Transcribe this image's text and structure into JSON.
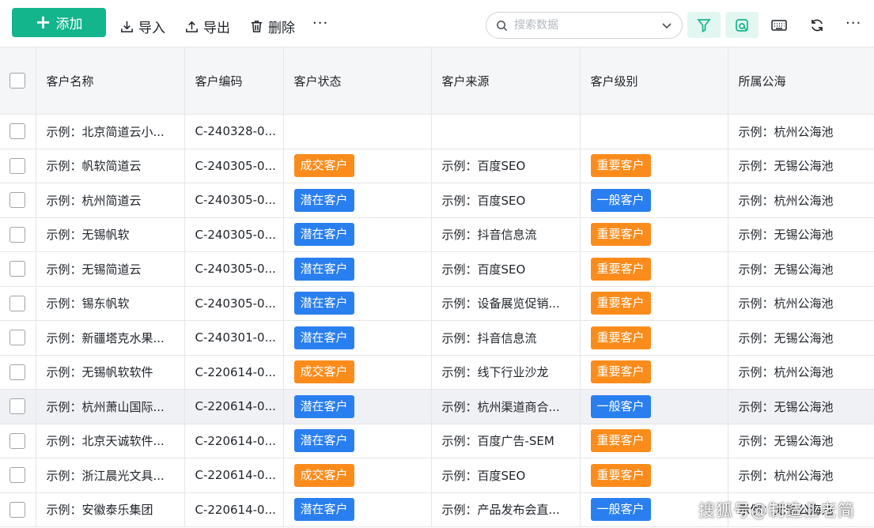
{
  "toolbar": {
    "add_label": "添加",
    "import_label": "导入",
    "export_label": "导出",
    "delete_label": "删除",
    "more_label": "···",
    "search_placeholder": "搜索数据",
    "right_more_label": "···"
  },
  "colors": {
    "accent": "#13b58d",
    "tag_orange": "#fb8c1c",
    "tag_blue": "#2a7ff0"
  },
  "table": {
    "columns": [
      "客户名称",
      "客户编码",
      "客户状态",
      "客户来源",
      "客户级别",
      "所属公海"
    ],
    "rows": [
      {
        "name": "示例：北京简道云小...",
        "code": "C-240328-0...",
        "status": "",
        "status_color": "",
        "source": "",
        "level": "",
        "level_color": "",
        "pool": "示例：杭州公海池"
      },
      {
        "name": "示例：帆软简道云",
        "code": "C-240305-0...",
        "status": "成交客户",
        "status_color": "orange",
        "source": "示例：百度SEO",
        "level": "重要客户",
        "level_color": "orange",
        "pool": "示例：无锡公海池"
      },
      {
        "name": "示例：杭州简道云",
        "code": "C-240305-0...",
        "status": "潜在客户",
        "status_color": "blue",
        "source": "示例：百度SEO",
        "level": "一般客户",
        "level_color": "blue",
        "pool": "示例：杭州公海池"
      },
      {
        "name": "示例：无锡帆软",
        "code": "C-240305-0...",
        "status": "潜在客户",
        "status_color": "blue",
        "source": "示例：抖音信息流",
        "level": "重要客户",
        "level_color": "orange",
        "pool": "示例：无锡公海池"
      },
      {
        "name": "示例：无锡简道云",
        "code": "C-240305-0...",
        "status": "潜在客户",
        "status_color": "blue",
        "source": "示例：百度SEO",
        "level": "重要客户",
        "level_color": "orange",
        "pool": "示例：无锡公海池"
      },
      {
        "name": "示例：锡东帆软",
        "code": "C-240305-0...",
        "status": "潜在客户",
        "status_color": "blue",
        "source": "示例：设备展览促销...",
        "level": "重要客户",
        "level_color": "orange",
        "pool": "示例：杭州公海池"
      },
      {
        "name": "示例：新疆塔克水果...",
        "code": "C-240301-0...",
        "status": "潜在客户",
        "status_color": "blue",
        "source": "示例：抖音信息流",
        "level": "重要客户",
        "level_color": "orange",
        "pool": "示例：无锡公海池"
      },
      {
        "name": "示例：无锡帆软软件",
        "code": "C-220614-0...",
        "status": "成交客户",
        "status_color": "orange",
        "source": "示例：线下行业沙龙",
        "level": "重要客户",
        "level_color": "orange",
        "pool": "示例：杭州公海池"
      },
      {
        "name": "示例：杭州萧山国际...",
        "code": "C-220614-0...",
        "status": "潜在客户",
        "status_color": "blue",
        "source": "示例：杭州渠道商合...",
        "level": "一般客户",
        "level_color": "blue",
        "pool": "示例：无锡公海池",
        "hover": true
      },
      {
        "name": "示例：北京天诚软件...",
        "code": "C-220614-0...",
        "status": "潜在客户",
        "status_color": "blue",
        "source": "示例：百度广告-SEM",
        "level": "重要客户",
        "level_color": "orange",
        "pool": "示例：无锡公海池"
      },
      {
        "name": "示例：浙江晨光文具...",
        "code": "C-220614-0...",
        "status": "成交客户",
        "status_color": "orange",
        "source": "示例：百度SEO",
        "level": "重要客户",
        "level_color": "orange",
        "pool": "示例：杭州公海池"
      },
      {
        "name": "示例：安徽泰乐集团",
        "code": "C-220614-0...",
        "status": "潜在客户",
        "status_color": "blue",
        "source": "示例：产品发布会直...",
        "level": "一般客户",
        "level_color": "blue",
        "pool": "示例：无锡公海池"
      }
    ]
  },
  "watermark": "搜狐号@制造业老简"
}
